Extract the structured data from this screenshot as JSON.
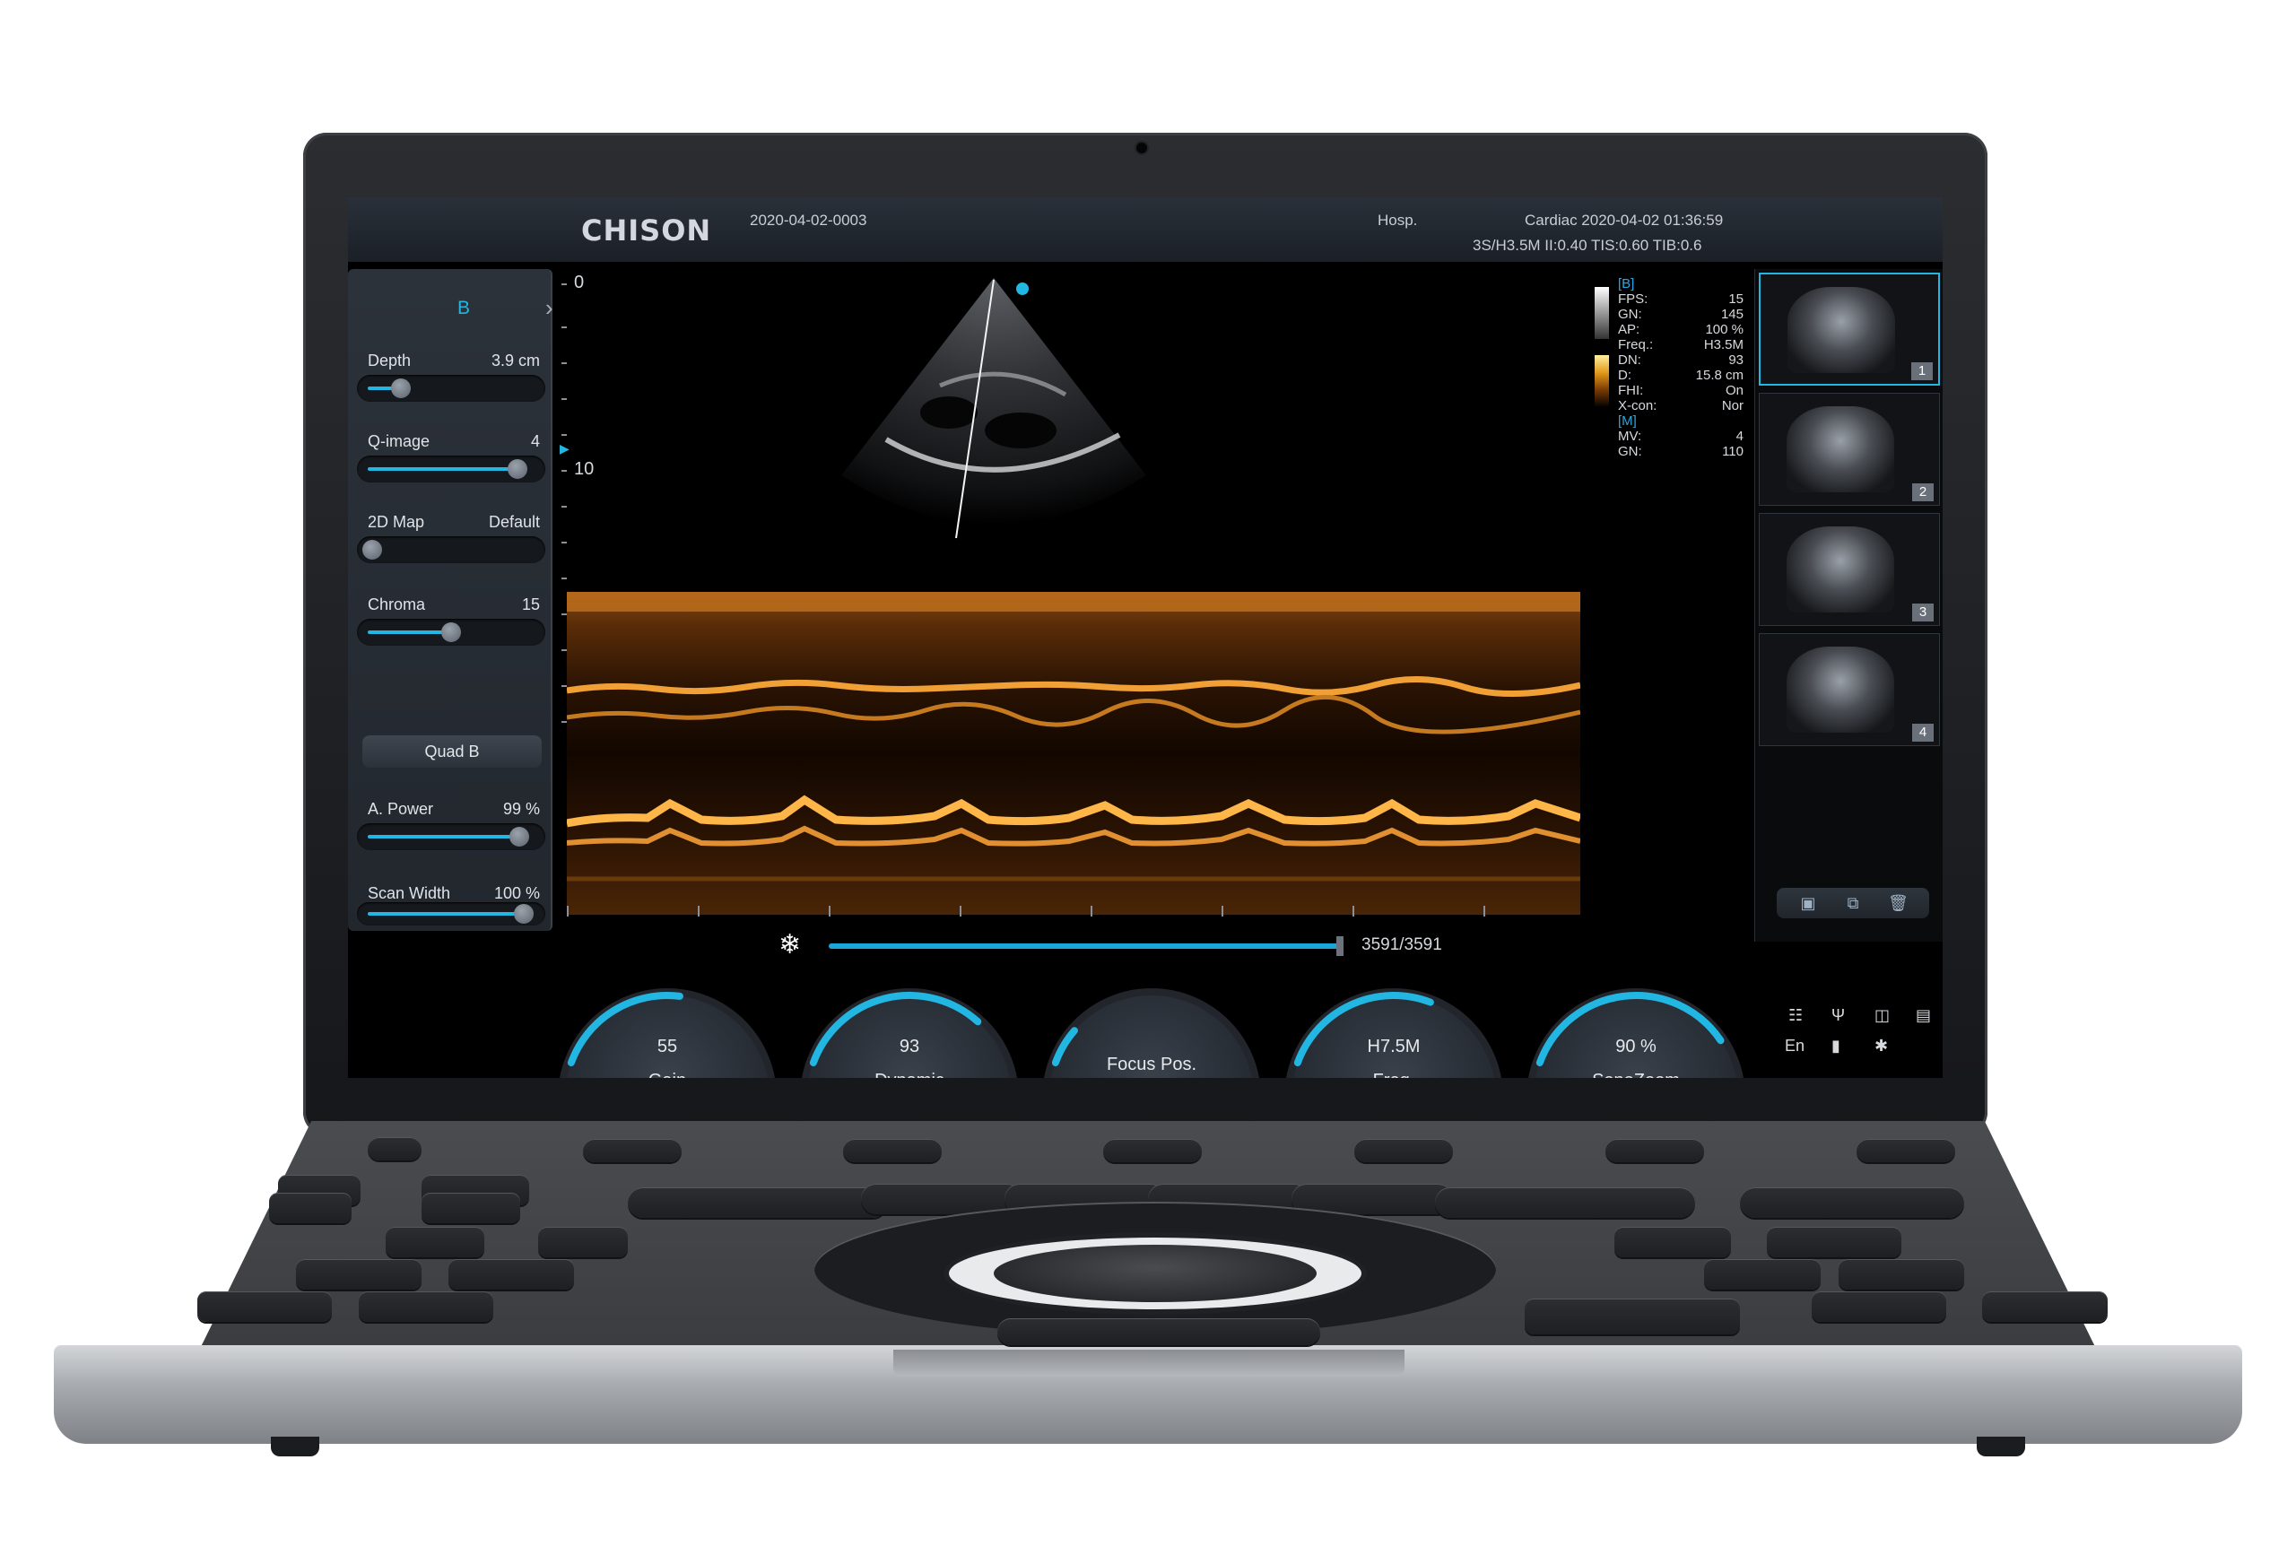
{
  "header": {
    "brand": "CHISON",
    "patient_id": "2020-04-02-0003",
    "hospital": "Hosp.",
    "exam_info": "Cardiac 2020-04-02 01:36:59",
    "probe_info": "3S/H3.5M II:0.40  TIS:0.60  TIB:0.6"
  },
  "left_panel": {
    "mode": "B",
    "next_icon": "chevron-right-icon",
    "depth": {
      "label": "Depth",
      "value": "3.9 cm",
      "level": 0.18
    },
    "qimage": {
      "label": "Q-image",
      "value": "4",
      "level": 0.92
    },
    "map2d": {
      "label": "2D Map",
      "value": "Default",
      "level": 0.0
    },
    "chroma": {
      "label": "Chroma",
      "value": "15",
      "level": 0.5
    },
    "quad_b": "Quad B",
    "apower": {
      "label": "A. Power",
      "value": "99 %",
      "level": 0.93
    },
    "scan_width": {
      "label": "Scan Width",
      "value": "100 %",
      "level": 0.96
    }
  },
  "depth_scale": {
    "top": "0",
    "mid": "10"
  },
  "cine": {
    "icon": "freeze-icon",
    "count": "3591/3591",
    "level": 1.0
  },
  "image_params": {
    "b_header": "[B]",
    "b_rows": [
      {
        "k": "FPS:",
        "v": "15"
      },
      {
        "k": "GN:",
        "v": "145"
      },
      {
        "k": "AP:",
        "v": "100 %"
      },
      {
        "k": "Freq.:",
        "v": "H3.5M"
      },
      {
        "k": "DN:",
        "v": "93"
      },
      {
        "k": "D:",
        "v": "15.8 cm"
      },
      {
        "k": "FHI:",
        "v": "On"
      },
      {
        "k": "X-con:",
        "v": "Nor"
      }
    ],
    "m_header": "[M]",
    "m_rows": [
      {
        "k": "MV:",
        "v": "4"
      },
      {
        "k": "GN:",
        "v": "110"
      }
    ]
  },
  "thumbnails": [
    {
      "num": "1"
    },
    {
      "num": "2"
    },
    {
      "num": "3"
    },
    {
      "num": "4"
    }
  ],
  "thumb_tools": [
    "image-export-icon",
    "copy-icon",
    "delete-icon"
  ],
  "knobs": [
    {
      "value": "55",
      "name": "Gain",
      "level": 0.55
    },
    {
      "value": "93",
      "name": "Dynamic",
      "level": 0.8
    },
    {
      "value": "",
      "name": "Focus Pos.",
      "level": 0.15
    },
    {
      "value": "H7.5M",
      "name": "Freq.",
      "level": 0.65
    },
    {
      "value": "90 %",
      "name": "SonoZoom",
      "level": 0.9
    }
  ],
  "sys_icons": {
    "network": "network-icon",
    "usb": "usb-icon",
    "storage": "database-icon",
    "device": "display-icon",
    "language": "En",
    "battery": "battery-icon",
    "bluetooth": "bluetooth-icon"
  },
  "colors": {
    "accent": "#22b6e3",
    "mmode": "#e39a2a"
  }
}
